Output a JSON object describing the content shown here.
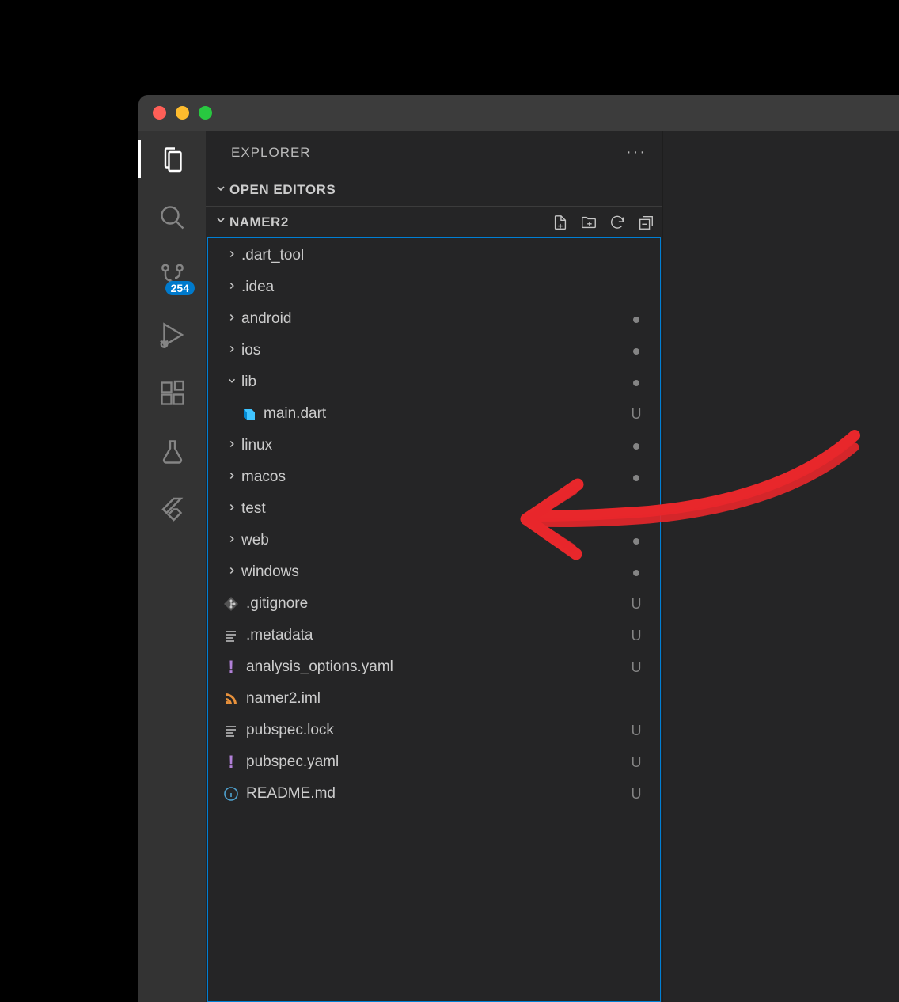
{
  "sidebar": {
    "title": "EXPLORER",
    "open_editors_label": "Open Editors",
    "folder_name": "NAMER2"
  },
  "activitybar": {
    "scm_badge": "254"
  },
  "tree": [
    {
      "type": "folder",
      "name": ".dart_tool",
      "depth": 0,
      "expanded": false,
      "status": ""
    },
    {
      "type": "folder",
      "name": ".idea",
      "depth": 0,
      "expanded": false,
      "status": ""
    },
    {
      "type": "folder",
      "name": "android",
      "depth": 0,
      "expanded": false,
      "status": "dot"
    },
    {
      "type": "folder",
      "name": "ios",
      "depth": 0,
      "expanded": false,
      "status": "dot"
    },
    {
      "type": "folder",
      "name": "lib",
      "depth": 0,
      "expanded": true,
      "status": "dot"
    },
    {
      "type": "file",
      "name": "main.dart",
      "icon": "dart",
      "depth": 1,
      "status": "U"
    },
    {
      "type": "folder",
      "name": "linux",
      "depth": 0,
      "expanded": false,
      "status": "dot"
    },
    {
      "type": "folder",
      "name": "macos",
      "depth": 0,
      "expanded": false,
      "status": "dot"
    },
    {
      "type": "folder",
      "name": "test",
      "depth": 0,
      "expanded": false,
      "status": "dot"
    },
    {
      "type": "folder",
      "name": "web",
      "depth": 0,
      "expanded": false,
      "status": "dot"
    },
    {
      "type": "folder",
      "name": "windows",
      "depth": 0,
      "expanded": false,
      "status": "dot"
    },
    {
      "type": "file",
      "name": ".gitignore",
      "icon": "git",
      "depth": 0,
      "status": "U"
    },
    {
      "type": "file",
      "name": ".metadata",
      "icon": "lines",
      "depth": 0,
      "status": "U"
    },
    {
      "type": "file",
      "name": "analysis_options.yaml",
      "icon": "exclaim",
      "depth": 0,
      "status": "U"
    },
    {
      "type": "file",
      "name": "namer2.iml",
      "icon": "rss",
      "depth": 0,
      "status": ""
    },
    {
      "type": "file",
      "name": "pubspec.lock",
      "icon": "lines",
      "depth": 0,
      "status": "U"
    },
    {
      "type": "file",
      "name": "pubspec.yaml",
      "icon": "exclaim",
      "depth": 0,
      "status": "U"
    },
    {
      "type": "file",
      "name": "README.md",
      "icon": "info",
      "depth": 0,
      "status": "U"
    }
  ]
}
